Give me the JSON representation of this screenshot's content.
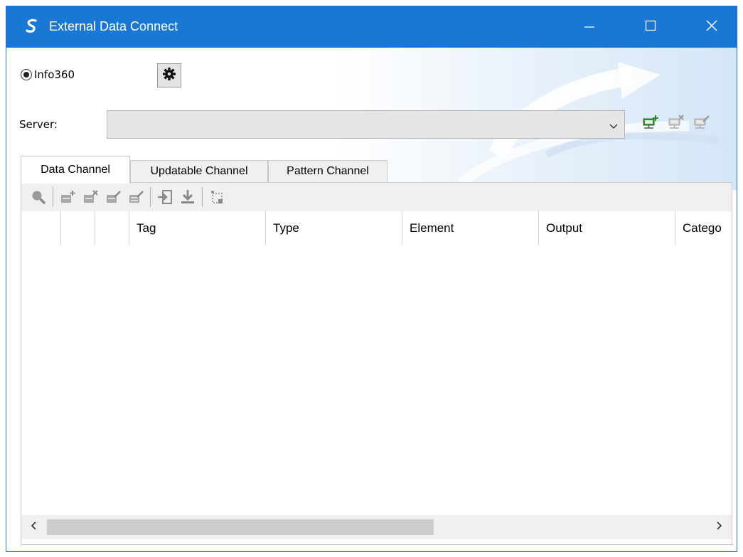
{
  "window": {
    "title": "External Data Connect",
    "title_bar_color": "#1a78d4",
    "icons": [
      "app-s-logo-icon",
      "minimize-icon",
      "maximize-icon",
      "close-icon"
    ]
  },
  "source": {
    "radio_label": "Info360",
    "radio_selected": true,
    "settings_icon": "gear-icon"
  },
  "server": {
    "label": "Server:",
    "value": "",
    "tool_icons": [
      "add-server-icon",
      "delete-server-icon",
      "edit-server-icon"
    ]
  },
  "tabs": [
    {
      "label": "Data Channel",
      "active": true
    },
    {
      "label": "Updatable Channel",
      "active": false
    },
    {
      "label": "Pattern Channel",
      "active": false
    }
  ],
  "toolbar": {
    "icons": [
      "search-icon",
      "add-row-icon",
      "delete-row-icon",
      "edit-row-icon",
      "edit-multiple-icon",
      "import-icon",
      "download-icon",
      "pattern-icon"
    ]
  },
  "grid": {
    "columns": [
      "",
      "",
      "",
      "Tag",
      "Type",
      "Element",
      "Output",
      "Catego"
    ]
  }
}
